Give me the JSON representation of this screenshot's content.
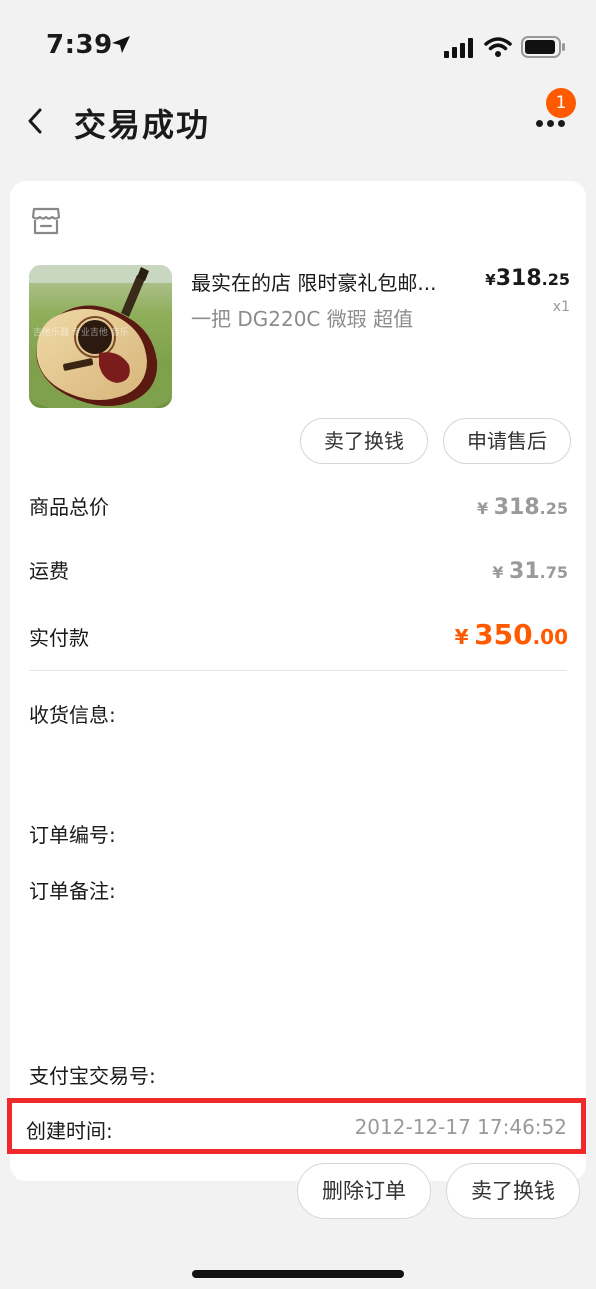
{
  "status_bar": {
    "time": "7:39"
  },
  "header": {
    "title": "交易成功",
    "badge_count": "1"
  },
  "product": {
    "title": "最实在的店 限时豪礼包邮...",
    "subtitle": "一把 DG220C 微瑕 超值",
    "price_yen": "¥",
    "price_int": "318",
    "price_dec": ".25",
    "quantity": "x1"
  },
  "item_actions": {
    "sell_label": "卖了换钱",
    "after_sale_label": "申请售后"
  },
  "summary": {
    "goods_total_label": "商品总价",
    "goods_total": {
      "yen": "¥",
      "int": "318",
      "dec": ".25"
    },
    "shipping_label": "运费",
    "shipping": {
      "yen": "¥",
      "int": "31",
      "dec": ".75"
    },
    "paid_label": "实付款",
    "paid": {
      "yen": "¥",
      "int": "350",
      "dec": ".00"
    }
  },
  "details": {
    "shipping_info_label": "收货信息:",
    "order_no_label": "订单编号:",
    "order_note_label": "订单备注:",
    "alipay_no_label": "支付宝交易号:",
    "created_label": "创建时间:",
    "created_value": "2012-12-17 17:46:52"
  },
  "footer": {
    "delete_label": "删除订单",
    "sell_label": "卖了换钱"
  },
  "colors": {
    "accent": "#ff5a00",
    "highlight": "#f02a2a"
  }
}
